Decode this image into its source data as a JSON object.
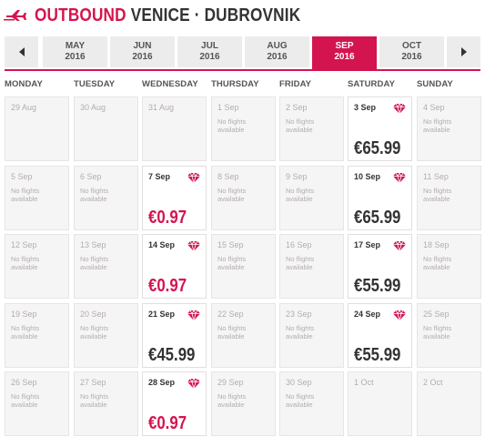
{
  "header": {
    "direction": "OUTBOUND",
    "route": "VENICE · DUBROVNIK"
  },
  "months": [
    {
      "month": "MAY",
      "year": "2016",
      "active": false
    },
    {
      "month": "JUN",
      "year": "2016",
      "active": false
    },
    {
      "month": "JUL",
      "year": "2016",
      "active": false
    },
    {
      "month": "AUG",
      "year": "2016",
      "active": false
    },
    {
      "month": "SEP",
      "year": "2016",
      "active": true
    },
    {
      "month": "OCT",
      "year": "2016",
      "active": false
    }
  ],
  "days": [
    "MONDAY",
    "TUESDAY",
    "WEDNESDAY",
    "THURSDAY",
    "FRIDAY",
    "SATURDAY",
    "SUNDAY"
  ],
  "no_flights_line1": "No flights",
  "no_flights_line2": "available",
  "calendar": [
    [
      {
        "date": "29 Aug",
        "status": "empty"
      },
      {
        "date": "30 Aug",
        "status": "empty"
      },
      {
        "date": "31 Aug",
        "status": "empty"
      },
      {
        "date": "1 Sep",
        "status": "none"
      },
      {
        "date": "2 Sep",
        "status": "none"
      },
      {
        "date": "3 Sep",
        "status": "price",
        "price": "€65.99",
        "highlight": false
      },
      {
        "date": "4 Sep",
        "status": "none"
      }
    ],
    [
      {
        "date": "5 Sep",
        "status": "none"
      },
      {
        "date": "6 Sep",
        "status": "none"
      },
      {
        "date": "7 Sep",
        "status": "price",
        "price": "€0.97",
        "highlight": true
      },
      {
        "date": "8 Sep",
        "status": "none"
      },
      {
        "date": "9 Sep",
        "status": "none"
      },
      {
        "date": "10 Sep",
        "status": "price",
        "price": "€65.99",
        "highlight": false
      },
      {
        "date": "11 Sep",
        "status": "none"
      }
    ],
    [
      {
        "date": "12 Sep",
        "status": "none"
      },
      {
        "date": "13 Sep",
        "status": "none"
      },
      {
        "date": "14 Sep",
        "status": "price",
        "price": "€0.97",
        "highlight": true
      },
      {
        "date": "15 Sep",
        "status": "none"
      },
      {
        "date": "16 Sep",
        "status": "none"
      },
      {
        "date": "17 Sep",
        "status": "price",
        "price": "€55.99",
        "highlight": false
      },
      {
        "date": "18 Sep",
        "status": "none"
      }
    ],
    [
      {
        "date": "19 Sep",
        "status": "none"
      },
      {
        "date": "20 Sep",
        "status": "none"
      },
      {
        "date": "21 Sep",
        "status": "price",
        "price": "€45.99",
        "highlight": false
      },
      {
        "date": "22 Sep",
        "status": "none"
      },
      {
        "date": "23 Sep",
        "status": "none"
      },
      {
        "date": "24 Sep",
        "status": "price",
        "price": "€55.99",
        "highlight": false
      },
      {
        "date": "25 Sep",
        "status": "none"
      }
    ],
    [
      {
        "date": "26 Sep",
        "status": "none"
      },
      {
        "date": "27 Sep",
        "status": "none"
      },
      {
        "date": "28 Sep",
        "status": "price",
        "price": "€0.97",
        "highlight": true
      },
      {
        "date": "29 Sep",
        "status": "none"
      },
      {
        "date": "30 Sep",
        "status": "none"
      },
      {
        "date": "1 Oct",
        "status": "empty"
      },
      {
        "date": "2 Oct",
        "status": "empty"
      }
    ]
  ],
  "colors": {
    "accent": "#d4144f",
    "text": "#333333",
    "muted": "#b3adad",
    "tab_bg": "#ececec",
    "cell_bg": "#f6f5f5"
  },
  "icons": {
    "header": "plane-takeoff-icon",
    "prev": "chevron-left-icon",
    "next": "chevron-right-icon",
    "fare": "diamond-fare-icon"
  }
}
